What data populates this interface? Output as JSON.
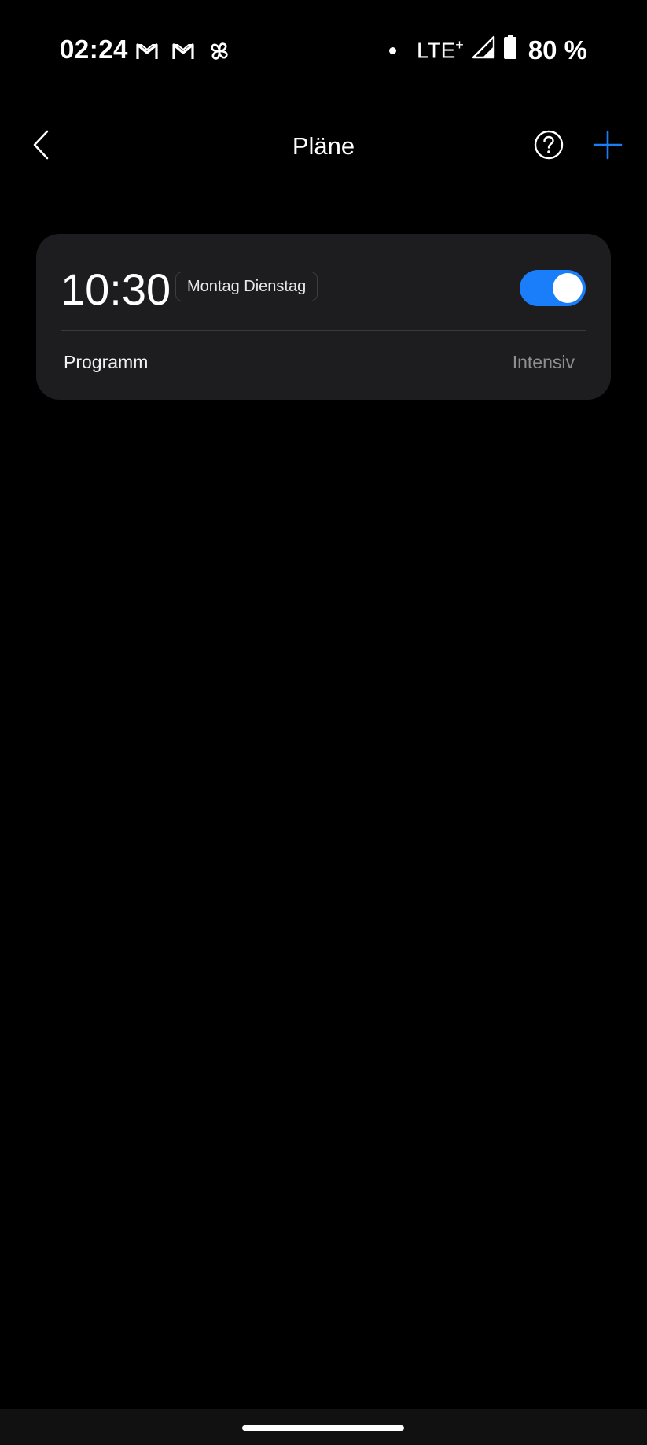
{
  "status_bar": {
    "time": "02:24",
    "notification_icons": [
      "gmail-icon",
      "gmail-icon",
      "pinwheel-icon"
    ],
    "network_dot": "dot-icon",
    "network": "LTE",
    "network_suffix": "+",
    "signal_icon": "signal-icon",
    "battery_icon": "battery-icon",
    "battery": "80 %"
  },
  "header": {
    "back_icon": "chevron-left-icon",
    "title": "Pläne",
    "help_icon": "help-icon",
    "add_icon": "plus-icon",
    "accent_color": "#1a7efb"
  },
  "schedules": [
    {
      "time": "10:30",
      "days": "Montag Dienstag",
      "enabled": true,
      "program_label": "Programm",
      "program_value": "Intensiv"
    }
  ],
  "colors": {
    "background": "#000000",
    "card": "#1d1d1f",
    "toggle_on": "#1a7efb",
    "secondary_text": "#8e8e93"
  }
}
